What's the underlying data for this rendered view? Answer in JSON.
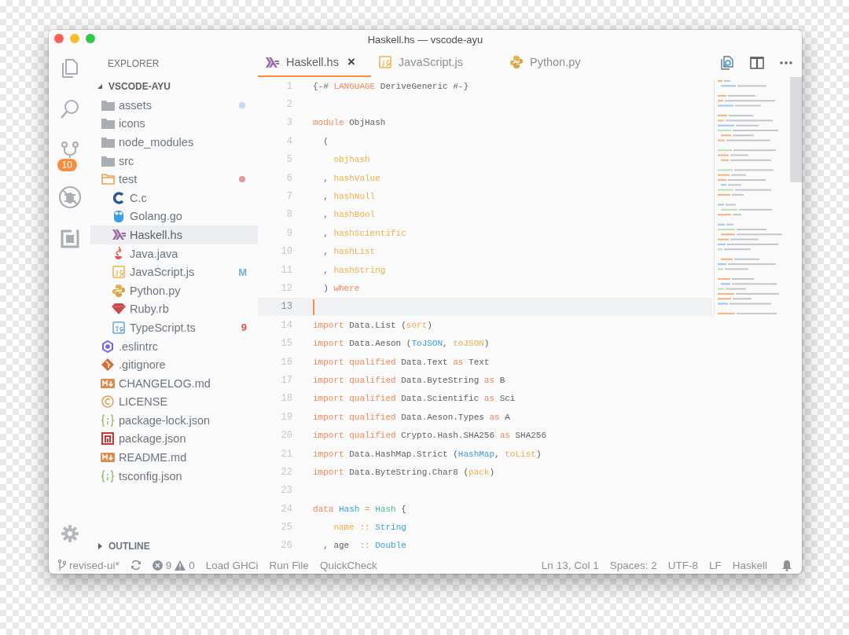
{
  "window": {
    "title": "Haskell.hs — vscode-ayu"
  },
  "activity_bar": {
    "badge": "10"
  },
  "sidebar": {
    "title": "EXPLORER",
    "root": {
      "label": "VSCODE-AYU",
      "expanded": true
    },
    "tree": [
      {
        "name": "assets",
        "kind": "folder",
        "expanded": false,
        "selected": false,
        "color": "#c5daf0"
      },
      {
        "name": "icons",
        "kind": "folder",
        "expanded": false,
        "selected": false
      },
      {
        "name": "node_modules",
        "kind": "folder",
        "expanded": false,
        "selected": false
      },
      {
        "name": "src",
        "kind": "folder",
        "expanded": false,
        "selected": false
      },
      {
        "name": "test",
        "kind": "folder",
        "expanded": true,
        "selected": false,
        "color": "#e29a9e",
        "children": [
          {
            "name": "C.c",
            "kind": "c",
            "selected": false
          },
          {
            "name": "Golang.go",
            "kind": "go",
            "selected": false
          },
          {
            "name": "Haskell.hs",
            "kind": "haskell",
            "selected": true
          },
          {
            "name": "Java.java",
            "kind": "java",
            "selected": false
          },
          {
            "name": "JavaScript.js",
            "kind": "js",
            "selected": false,
            "badge": {
              "text": "M",
              "kind": "modified"
            }
          },
          {
            "name": "Python.py",
            "kind": "python",
            "selected": false
          },
          {
            "name": "Ruby.rb",
            "kind": "ruby",
            "selected": false
          },
          {
            "name": "TypeScript.ts",
            "kind": "ts",
            "selected": false,
            "badge": {
              "text": "9",
              "kind": "error"
            }
          }
        ]
      },
      {
        "name": ".eslintrc",
        "kind": "eslint",
        "selected": false
      },
      {
        "name": ".gitignore",
        "kind": "git",
        "selected": false
      },
      {
        "name": "CHANGELOG.md",
        "kind": "markdown",
        "selected": false
      },
      {
        "name": "LICENSE",
        "kind": "license",
        "selected": false
      },
      {
        "name": "package-lock.json",
        "kind": "json",
        "selected": false
      },
      {
        "name": "package.json",
        "kind": "npm",
        "selected": false
      },
      {
        "name": "README.md",
        "kind": "markdown",
        "selected": false
      },
      {
        "name": "tsconfig.json",
        "kind": "json",
        "selected": false
      }
    ],
    "outline": {
      "label": "OUTLINE",
      "expanded": false
    }
  },
  "tabs": [
    {
      "label": "Haskell.hs",
      "kind": "haskell",
      "selected": true,
      "close": "×"
    },
    {
      "label": "JavaScript.js",
      "kind": "js",
      "selected": false
    },
    {
      "label": "Python.py",
      "kind": "python",
      "selected": false
    }
  ],
  "editor": {
    "lines": [
      {
        "number": "1",
        "current": false,
        "tokens": [
          {
            "text": "{-# ",
            "kind": "text"
          },
          {
            "text": "LANGUAGE",
            "kind": "kw"
          },
          {
            "text": " DeriveGeneric #-}",
            "kind": "text"
          }
        ]
      },
      {
        "number": "2",
        "current": false
      },
      {
        "number": "3",
        "current": false,
        "tokens": [
          {
            "text": "module",
            "kind": "kw"
          },
          {
            "text": " ObjHash",
            "kind": "text"
          }
        ]
      },
      {
        "number": "4",
        "current": false,
        "tokens": [
          {
            "text": "  (",
            "kind": "text"
          }
        ]
      },
      {
        "number": "5",
        "current": false,
        "tokens": [
          {
            "text": "    objhash",
            "kind": "fn"
          }
        ]
      },
      {
        "number": "6",
        "current": false,
        "tokens": [
          {
            "text": "  , ",
            "kind": "text"
          },
          {
            "text": "hashValue",
            "kind": "fn"
          }
        ]
      },
      {
        "number": "7",
        "current": false,
        "tokens": [
          {
            "text": "  , ",
            "kind": "text"
          },
          {
            "text": "hashNull",
            "kind": "fn"
          }
        ]
      },
      {
        "number": "8",
        "current": false,
        "tokens": [
          {
            "text": "  , ",
            "kind": "text"
          },
          {
            "text": "hashBool",
            "kind": "fn"
          }
        ]
      },
      {
        "number": "9",
        "current": false,
        "tokens": [
          {
            "text": "  , ",
            "kind": "text"
          },
          {
            "text": "hashScientific",
            "kind": "fn"
          }
        ]
      },
      {
        "number": "10",
        "current": false,
        "tokens": [
          {
            "text": "  , ",
            "kind": "text"
          },
          {
            "text": "hashList",
            "kind": "fn"
          }
        ]
      },
      {
        "number": "11",
        "current": false,
        "tokens": [
          {
            "text": "  , ",
            "kind": "text"
          },
          {
            "text": "hashString",
            "kind": "fn"
          }
        ]
      },
      {
        "number": "12",
        "current": false,
        "tokens": [
          {
            "text": "  ) ",
            "kind": "text"
          },
          {
            "text": "where",
            "kind": "kw"
          }
        ]
      },
      {
        "number": "13",
        "current": true
      },
      {
        "number": "14",
        "current": false,
        "tokens": [
          {
            "text": "import",
            "kind": "kw"
          },
          {
            "text": " Data.List (",
            "kind": "text"
          },
          {
            "text": "sort",
            "kind": "fn"
          },
          {
            "text": ")",
            "kind": "text"
          }
        ]
      },
      {
        "number": "15",
        "current": false,
        "tokens": [
          {
            "text": "import",
            "kind": "kw"
          },
          {
            "text": " Data.Aeson (",
            "kind": "text"
          },
          {
            "text": "ToJSON",
            "kind": "type"
          },
          {
            "text": ", ",
            "kind": "text"
          },
          {
            "text": "toJSON",
            "kind": "fn"
          },
          {
            "text": ")",
            "kind": "text"
          }
        ]
      },
      {
        "number": "16",
        "current": false,
        "tokens": [
          {
            "text": "import qualified",
            "kind": "kw"
          },
          {
            "text": " Data.Text ",
            "kind": "text"
          },
          {
            "text": "as",
            "kind": "kw"
          },
          {
            "text": " Text",
            "kind": "text"
          }
        ]
      },
      {
        "number": "17",
        "current": false,
        "tokens": [
          {
            "text": "import qualified",
            "kind": "kw"
          },
          {
            "text": " Data.ByteString ",
            "kind": "text"
          },
          {
            "text": "as",
            "kind": "kw"
          },
          {
            "text": " B",
            "kind": "text"
          }
        ]
      },
      {
        "number": "18",
        "current": false,
        "tokens": [
          {
            "text": "import qualified",
            "kind": "kw"
          },
          {
            "text": " Data.Scientific ",
            "kind": "text"
          },
          {
            "text": "as",
            "kind": "kw"
          },
          {
            "text": " Sci",
            "kind": "text"
          }
        ]
      },
      {
        "number": "19",
        "current": false,
        "tokens": [
          {
            "text": "import qualified",
            "kind": "kw"
          },
          {
            "text": " Data.Aeson.Types ",
            "kind": "text"
          },
          {
            "text": "as",
            "kind": "kw"
          },
          {
            "text": " A",
            "kind": "text"
          }
        ]
      },
      {
        "number": "20",
        "current": false,
        "tokens": [
          {
            "text": "import qualified",
            "kind": "kw"
          },
          {
            "text": " Crypto.Hash.SHA256 ",
            "kind": "text"
          },
          {
            "text": "as",
            "kind": "kw"
          },
          {
            "text": " SHA256",
            "kind": "text"
          }
        ]
      },
      {
        "number": "21",
        "current": false,
        "tokens": [
          {
            "text": "import",
            "kind": "kw"
          },
          {
            "text": " Data.HashMap.Strict (",
            "kind": "text"
          },
          {
            "text": "HashMap",
            "kind": "type"
          },
          {
            "text": ", ",
            "kind": "text"
          },
          {
            "text": "toList",
            "kind": "fn"
          },
          {
            "text": ")",
            "kind": "text"
          }
        ]
      },
      {
        "number": "22",
        "current": false,
        "tokens": [
          {
            "text": "import",
            "kind": "kw"
          },
          {
            "text": " Data.ByteString.Char8 (",
            "kind": "text"
          },
          {
            "text": "pack",
            "kind": "fn"
          },
          {
            "text": ")",
            "kind": "text"
          }
        ]
      },
      {
        "number": "23",
        "current": false
      },
      {
        "number": "24",
        "current": false,
        "tokens": [
          {
            "text": "data",
            "kind": "kw"
          },
          {
            "text": " Hash",
            "kind": "type"
          },
          {
            "text": " =",
            "kind": "op"
          },
          {
            "text": " Hash",
            "kind": "ctor"
          },
          {
            "text": " {",
            "kind": "text"
          }
        ]
      },
      {
        "number": "25",
        "current": false,
        "tokens": [
          {
            "text": "    name",
            "kind": "fn"
          },
          {
            "text": " ::",
            "kind": "op"
          },
          {
            "text": " String",
            "kind": "type"
          }
        ]
      },
      {
        "number": "26",
        "current": false,
        "tokens": [
          {
            "text": "  , age  ",
            "kind": "text"
          },
          {
            "text": "::",
            "kind": "op"
          },
          {
            "text": " Double",
            "kind": "type"
          }
        ]
      }
    ]
  },
  "status_bar": {
    "branch": "revised-ui*",
    "errors": "9",
    "warnings": "0",
    "commands": [
      "Load GHCi",
      "Run File",
      "QuickCheck"
    ],
    "right": [
      "Ln 13, Col 1",
      "Spaces: 2",
      "UTF-8",
      "LF",
      "Haskell"
    ]
  }
}
